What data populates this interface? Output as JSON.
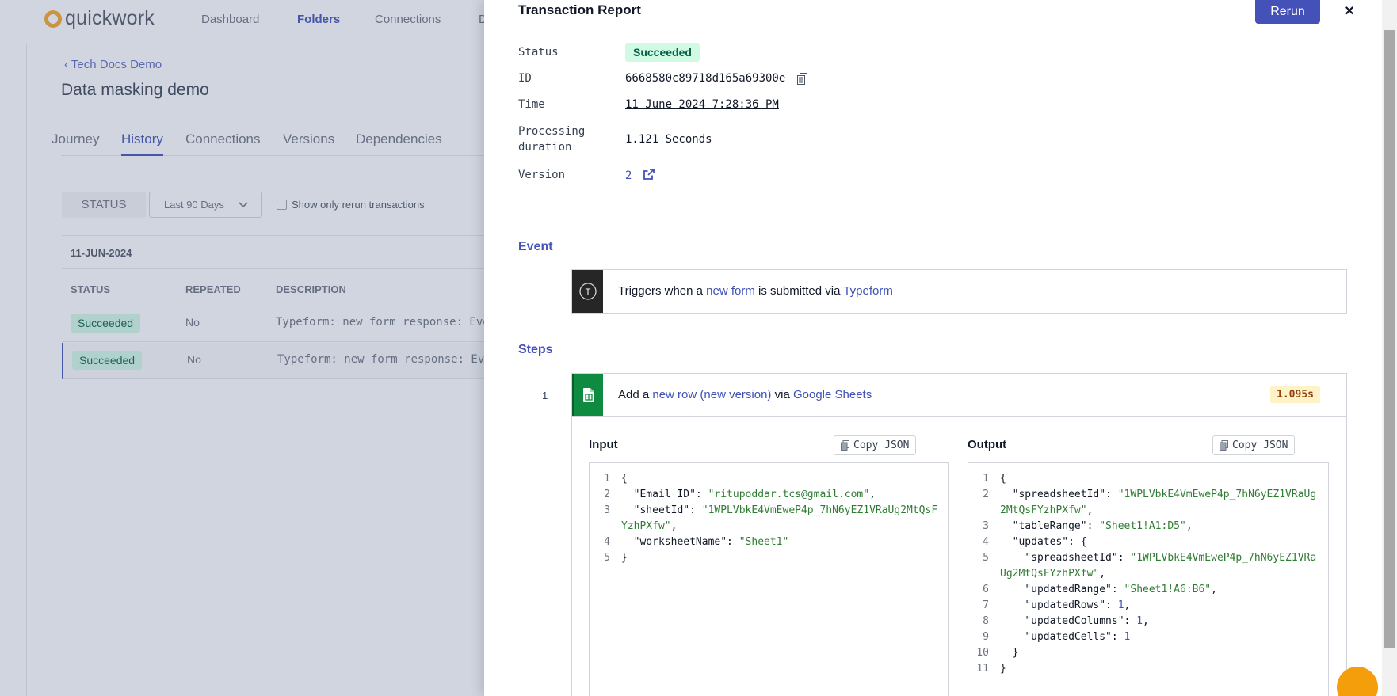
{
  "app": {
    "logo_text": "quickwork",
    "nav": [
      "Dashboard",
      "Folders",
      "Connections",
      "D"
    ],
    "breadcrumb": "‹ Tech Docs Demo",
    "page_title": "Data masking demo",
    "tabs": [
      "Journey",
      "History",
      "Connections",
      "Versions",
      "Dependencies"
    ],
    "filters": {
      "status": "STATUS",
      "range": "Last 90 Days",
      "rerun_only": "Show only rerun transactions"
    },
    "date_group": "11-JUN-2024",
    "table_headers": [
      "STATUS",
      "REPEATED",
      "DESCRIPTION"
    ],
    "rows": [
      {
        "status": "Succeeded",
        "repeated": "No",
        "description": "Typeform: new form response: Ever"
      },
      {
        "status": "Succeeded",
        "repeated": "No",
        "description": "Typeform: new form response: Ever"
      }
    ]
  },
  "report": {
    "title": "Transaction Report",
    "rerun_label": "Rerun",
    "close_label": "×",
    "labels": {
      "status": "Status",
      "id": "ID",
      "time": "Time",
      "processing_line1": "Processing",
      "processing_line2": "duration",
      "version": "Version"
    },
    "status": "Succeeded",
    "id": "6668580c89718d165a69300e",
    "time": "11 June 2024 7:28:36 PM",
    "processing_duration": "1.121 Seconds",
    "version": "2",
    "event_title": "Event",
    "event": {
      "prefix": "Triggers when a",
      "trigger": "new form",
      "middle": "is submitted via",
      "app": "Typeform",
      "icon_letter": "T"
    },
    "steps_title": "Steps",
    "step": {
      "number": "1",
      "prefix": "Add a",
      "action": "new row (new version)",
      "middle": "via",
      "app": "Google Sheets",
      "duration": "1.095s"
    },
    "input_title": "Input",
    "output_title": "Output",
    "copy_json_label": "Copy JSON",
    "input_lines": [
      {
        "n": "1",
        "parts": [
          [
            "p",
            "{"
          ]
        ]
      },
      {
        "n": "2",
        "parts": [
          [
            "k",
            "  \"Email ID\": "
          ],
          [
            "s",
            "\"ritupoddar.tcs@gmail.com\""
          ],
          [
            "k",
            ","
          ]
        ]
      },
      {
        "n": "3",
        "parts": [
          [
            "k",
            "  \"sheetId\": "
          ],
          [
            "s",
            "\"1WPLVbkE4VmEweP4p_7hN6yEZ1VRaUg2MtQsFYzhPXfw\""
          ],
          [
            "k",
            ","
          ]
        ]
      },
      {
        "n": "4",
        "parts": [
          [
            "k",
            "  \"worksheetName\": "
          ],
          [
            "s",
            "\"Sheet1\""
          ]
        ]
      },
      {
        "n": "5",
        "parts": [
          [
            "p",
            "}"
          ]
        ]
      }
    ],
    "output_lines": [
      {
        "n": "1",
        "parts": [
          [
            "p",
            "{"
          ]
        ]
      },
      {
        "n": "2",
        "parts": [
          [
            "k",
            "  \"spreadsheetId\": "
          ],
          [
            "s",
            "\"1WPLVbkE4VmEweP4p_7hN6yEZ1VRaUg2MtQsFYzhPXfw\""
          ],
          [
            "k",
            ","
          ]
        ]
      },
      {
        "n": "3",
        "parts": [
          [
            "k",
            "  \"tableRange\": "
          ],
          [
            "s",
            "\"Sheet1!A1:D5\""
          ],
          [
            "k",
            ","
          ]
        ]
      },
      {
        "n": "4",
        "parts": [
          [
            "k",
            "  \"updates\": {"
          ]
        ]
      },
      {
        "n": "5",
        "parts": [
          [
            "k",
            "    \"spreadsheetId\": "
          ],
          [
            "s",
            "\"1WPLVbkE4VmEweP4p_7hN6yEZ1VRaUg2MtQsFYzhPXfw\""
          ],
          [
            "k",
            ","
          ]
        ]
      },
      {
        "n": "6",
        "parts": [
          [
            "k",
            "    \"updatedRange\": "
          ],
          [
            "s",
            "\"Sheet1!A6:B6\""
          ],
          [
            "k",
            ","
          ]
        ]
      },
      {
        "n": "7",
        "parts": [
          [
            "k",
            "    \"updatedRows\": "
          ],
          [
            "n",
            "1"
          ],
          [
            "k",
            ","
          ]
        ]
      },
      {
        "n": "8",
        "parts": [
          [
            "k",
            "    \"updatedColumns\": "
          ],
          [
            "n",
            "1"
          ],
          [
            "k",
            ","
          ]
        ]
      },
      {
        "n": "9",
        "parts": [
          [
            "k",
            "    \"updatedCells\": "
          ],
          [
            "n",
            "1"
          ]
        ]
      },
      {
        "n": "10",
        "parts": [
          [
            "k",
            "  }"
          ]
        ]
      },
      {
        "n": "11",
        "parts": [
          [
            "p",
            "}"
          ]
        ]
      }
    ]
  },
  "colors": {
    "accent": "#4451b8",
    "success_bg": "#d1fae5",
    "success_text": "#065f46",
    "duration_bg": "#fef3c7",
    "typeform_icon_bg": "#262627",
    "sheets_icon_bg": "#0f8a41"
  },
  "icons": [
    "copy-icon",
    "external-link-icon",
    "close-icon",
    "typeform-icon",
    "google-sheets-icon",
    "chevron-down-icon",
    "chat-icon"
  ]
}
